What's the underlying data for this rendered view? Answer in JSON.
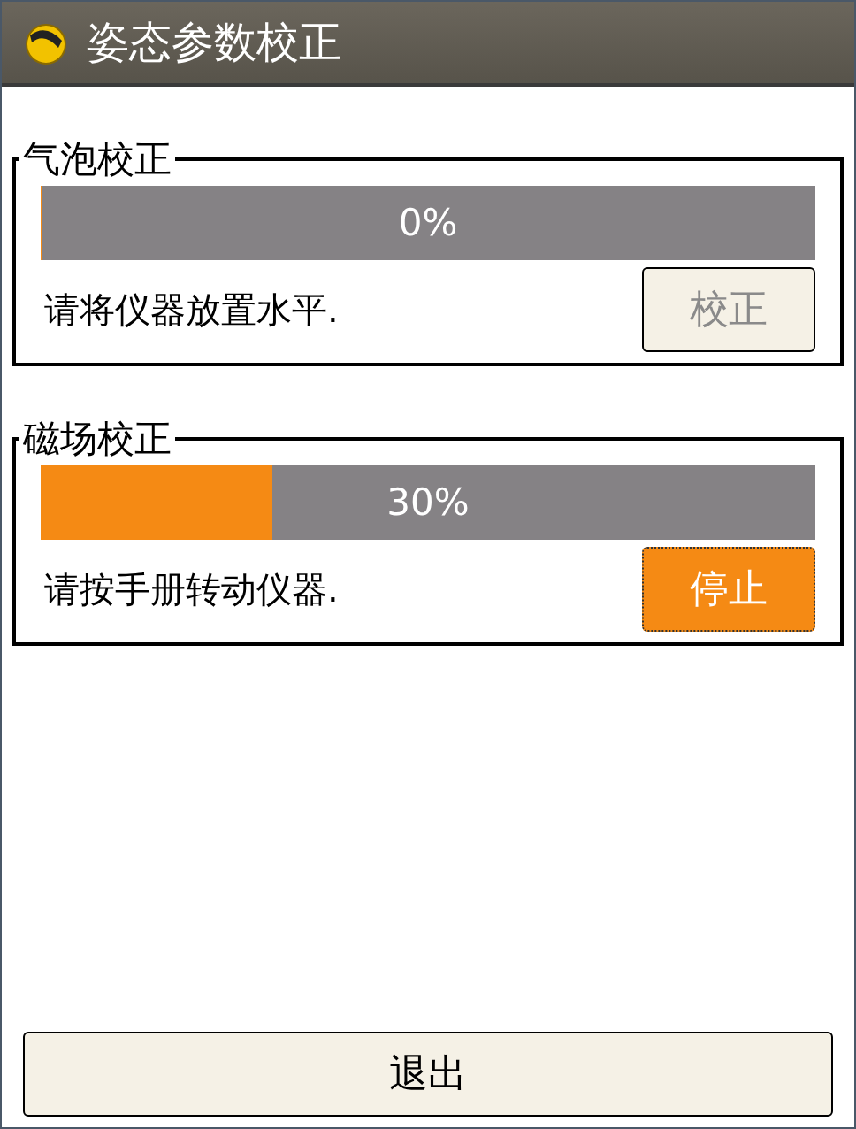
{
  "window": {
    "title": "姿态参数校正"
  },
  "groups": [
    {
      "title": "气泡校正",
      "level": 0,
      "reading": "0%",
      "message": "请将仪器放置水平.",
      "button": {
        "label": "校正",
        "disabled": true,
        "highlighted": false
      }
    },
    {
      "title": "磁场校正",
      "level": 0.3,
      "reading": "30%",
      "message": "请按手册转动仪器.",
      "button": {
        "label": "停止",
        "disabled": false,
        "highlighted": true
      }
    }
  ],
  "exit_button": {
    "label": "退出"
  }
}
